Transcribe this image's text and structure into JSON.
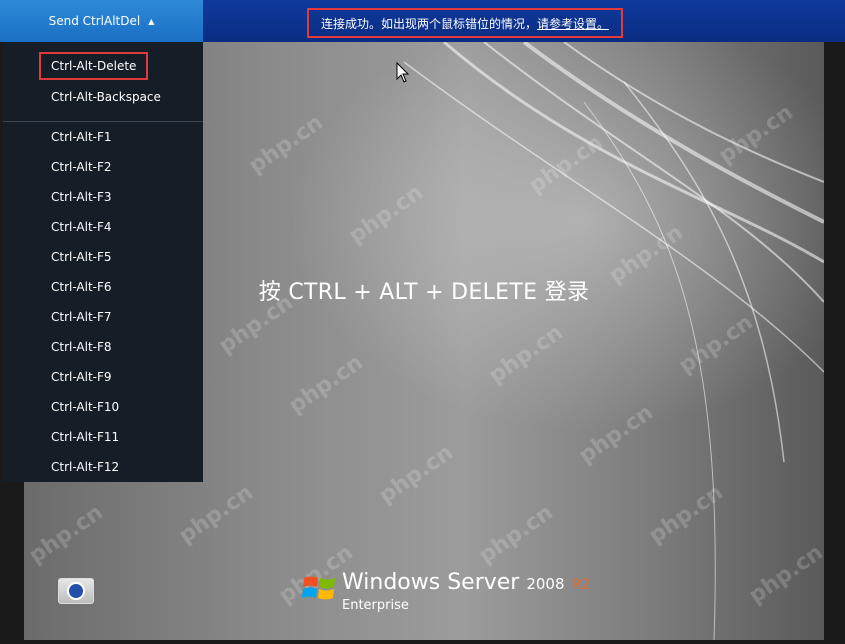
{
  "toolbar": {
    "send_label": "Send CtrlAltDel",
    "status_text": "连接成功。如出现两个鼠标错位的情况，",
    "status_link": "请参考设置。"
  },
  "menu": {
    "items": [
      "Ctrl-Alt-Delete",
      "Ctrl-Alt-Backspace",
      "Ctrl-Alt-F1",
      "Ctrl-Alt-F2",
      "Ctrl-Alt-F3",
      "Ctrl-Alt-F4",
      "Ctrl-Alt-F5",
      "Ctrl-Alt-F6",
      "Ctrl-Alt-F7",
      "Ctrl-Alt-F8",
      "Ctrl-Alt-F9",
      "Ctrl-Alt-F10",
      "Ctrl-Alt-F11",
      "Ctrl-Alt-F12"
    ]
  },
  "screen": {
    "prompt": "按 CTRL + ALT + DELETE 登录",
    "logo_brand": "Windows Server",
    "logo_version": "2008",
    "logo_release": "R2",
    "logo_edition": "Enterprise"
  },
  "watermark": "php.cn",
  "colors": {
    "toolbar_bg": "#0a2c82",
    "send_button": "#1a6fc4",
    "menu_bg": "#151d27",
    "highlight": "#e03a3a",
    "r2": "#e46a2a"
  }
}
